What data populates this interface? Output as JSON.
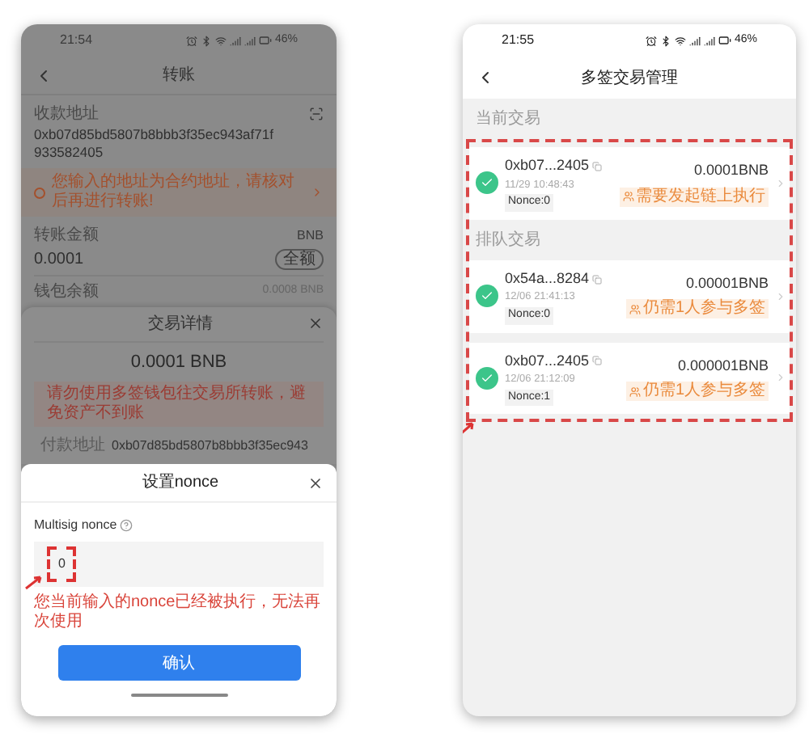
{
  "left_phone": {
    "status_bar": {
      "time": "21:54",
      "battery": "46%"
    },
    "header": {
      "title": "转账"
    },
    "recipient": {
      "label": "收款地址",
      "address": "0xb07d85bd5807b8bbb3f35ec943af71f933582405"
    },
    "warning": "您输入的地址为合约地址，请核对后再进行转账!",
    "amount": {
      "label": "转账金额",
      "token": "BNB",
      "value": "0.0001",
      "max_button": "全额"
    },
    "balance": {
      "label": "钱包余额",
      "value": "0.0008 BNB"
    },
    "details_sheet": {
      "title": "交易详情",
      "amount": "0.0001 BNB",
      "notice": "请勿使用多签钱包往交易所转账，避免资产不到账",
      "payer_label": "付款地址",
      "payer_address": "0xb07d85bd5807b8bbb3f35ec943"
    },
    "nonce_dialog": {
      "title": "设置nonce",
      "field_label": "Multisig nonce",
      "value": "0",
      "error": "您当前输入的nonce已经被执行，无法再次使用",
      "confirm_button": "确认"
    }
  },
  "right_phone": {
    "status_bar": {
      "time": "21:55",
      "battery": "46%"
    },
    "header": {
      "title": "多签交易管理"
    },
    "sections": [
      {
        "title": "当前交易",
        "transactions": [
          {
            "address": "0xb07...2405",
            "time": "11/29 10:48:43",
            "nonce": "Nonce:0",
            "amount": "0.0001BNB",
            "status": "需要发起链上执行"
          }
        ]
      },
      {
        "title": "排队交易",
        "transactions": [
          {
            "address": "0x54a...8284",
            "time": "12/06 21:41:13",
            "nonce": "Nonce:0",
            "amount": "0.00001BNB",
            "status": "仍需1人参与多签"
          },
          {
            "address": "0xb07...2405",
            "time": "12/06 21:12:09",
            "nonce": "Nonce:1",
            "amount": "0.000001BNB",
            "status": "仍需1人参与多签"
          }
        ]
      }
    ]
  }
}
